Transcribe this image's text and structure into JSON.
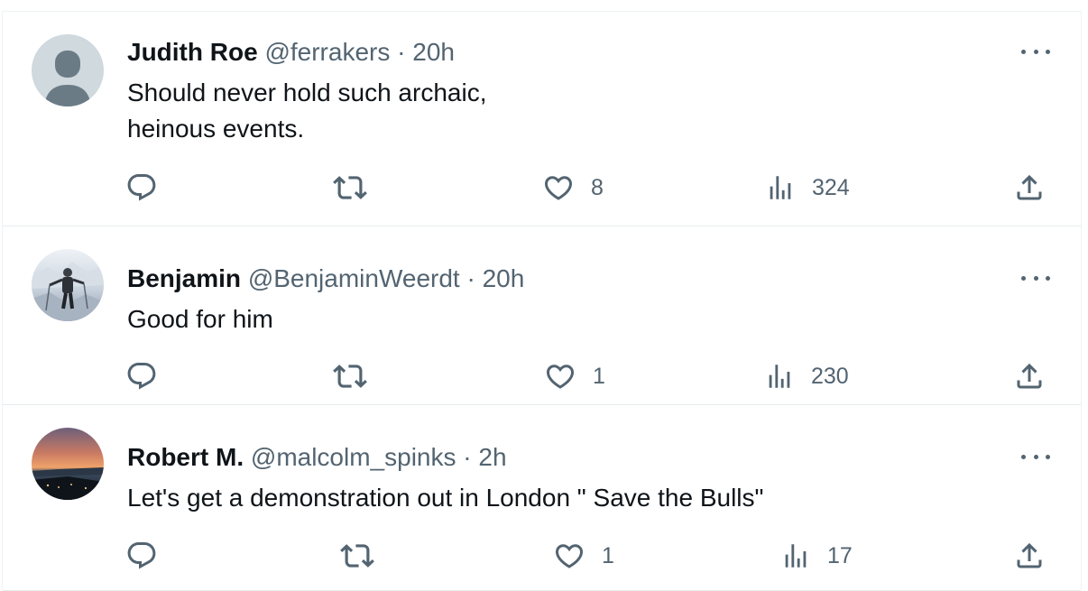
{
  "tweets": [
    {
      "name": "Judith Roe",
      "handle": "@ferrakers",
      "time": "20h",
      "text": "Should never hold such archaic,\nheinous events.",
      "likes": "8",
      "views": "324",
      "avatar": "default-avatar"
    },
    {
      "name": "Benjamin",
      "handle": "@BenjaminWeerdt",
      "time": "20h",
      "text": "Good for him",
      "likes": "1",
      "views": "230",
      "avatar": "photo-hiker-snow"
    },
    {
      "name": "Robert M.",
      "handle": "@malcolm_spinks",
      "time": "2h",
      "text": "Let's get a demonstration out in London \" Save the Bulls\"",
      "likes": "1",
      "views": "17",
      "avatar": "photo-sunset-coast"
    }
  ],
  "separator": "·",
  "colors": {
    "text": "#0f1419",
    "secondary": "#536471",
    "border": "#e7ecef"
  }
}
